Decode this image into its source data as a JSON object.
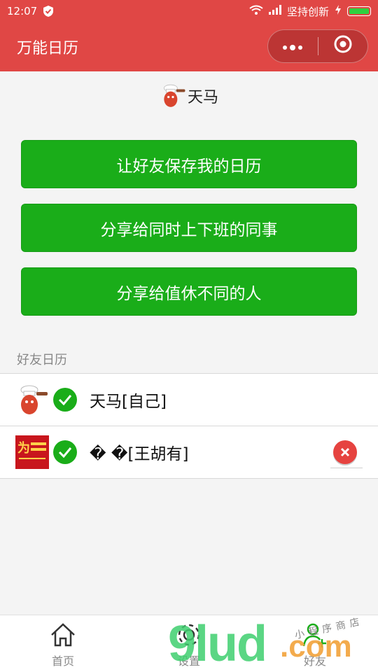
{
  "status_bar": {
    "time": "12:07",
    "carrier": "坚持创新"
  },
  "navbar": {
    "title": "万能日历",
    "capsule_more_icon": "dots-icon",
    "capsule_close_icon": "target-icon"
  },
  "header": {
    "username": "天马"
  },
  "buttons": {
    "save_calendar": "让好友保存我的日历",
    "share_same_shift": "分享给同时上下班的同事",
    "share_diff_rest": "分享给值休不同的人"
  },
  "friends": {
    "section_title": "好友日历",
    "items": [
      {
        "name": "天马[自己]",
        "checked": true,
        "deletable": false
      },
      {
        "name": "� �[王胡有]",
        "checked": true,
        "deletable": true
      }
    ]
  },
  "tabbar": {
    "tabs": [
      {
        "label": "首页",
        "icon": "home-icon"
      },
      {
        "label": "设置",
        "icon": "gear-icon"
      },
      {
        "label": "好友",
        "icon": "add-user-icon"
      }
    ]
  },
  "watermark": {
    "text": "9lud",
    "suffix": ".com",
    "tagline": "小程序商店"
  },
  "colors": {
    "brand_red": "#e04745",
    "button_green": "#1aad19",
    "delete_red": "#e64340"
  }
}
